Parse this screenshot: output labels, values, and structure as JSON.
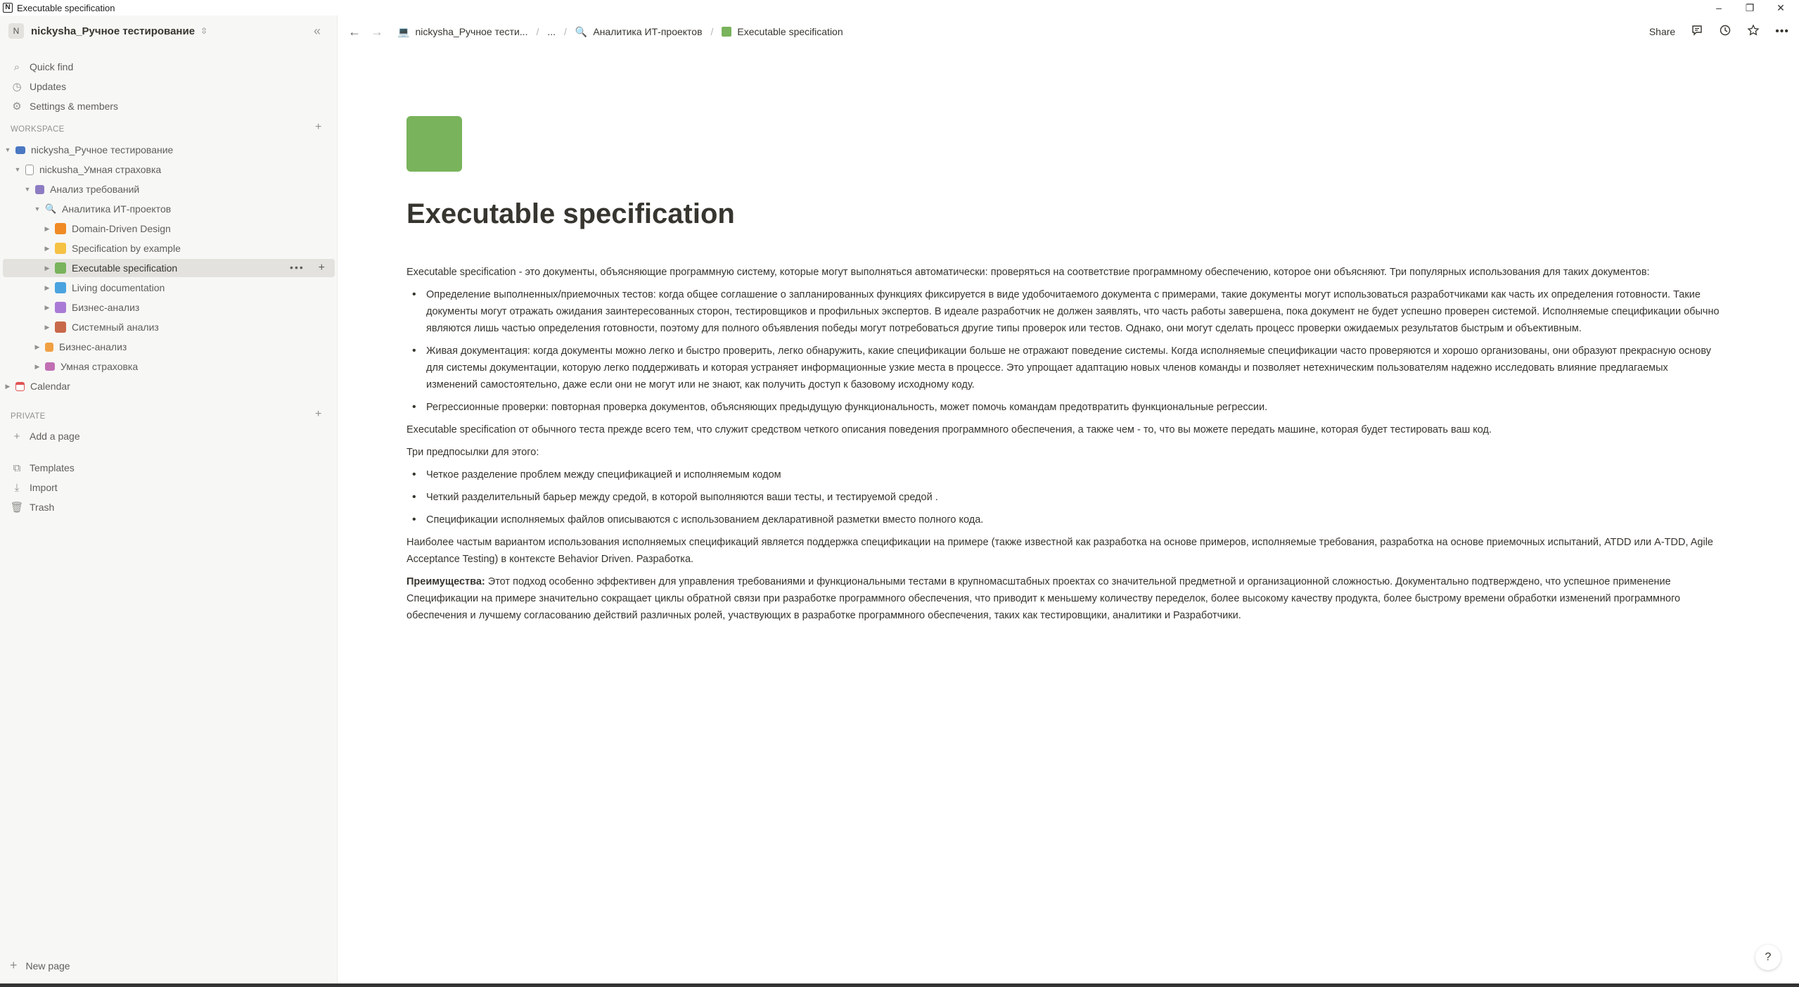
{
  "window": {
    "title": "Executable specification",
    "app_icon": "N",
    "controls": {
      "minimize": "–",
      "restore": "❐",
      "close": "✕"
    }
  },
  "sidebar": {
    "workspace_avatar": "N",
    "workspace_name": "nickysha_Ручное тестирование",
    "collapse_icon": "«",
    "nav": [
      {
        "label": "Quick find",
        "icon": "search-icon"
      },
      {
        "label": "Updates",
        "icon": "clock-icon"
      },
      {
        "label": "Settings & members",
        "icon": "gear-icon"
      }
    ],
    "workspace_label": "WORKSPACE",
    "private_label": "PRIVATE",
    "tree": [
      {
        "label": "nickysha_Ручное тестирование",
        "icon_color": "#4a78c2"
      },
      {
        "label": "nickusha_Умная страховка",
        "icon_color": "#9b9a97"
      },
      {
        "label": "Анализ требований",
        "icon_color": "#8e7cc3"
      },
      {
        "label": "Аналитика ИТ-проектов",
        "icon_color": "#4a78c2"
      },
      {
        "label": "Domain-Driven Design",
        "icon_color": "#f08a24"
      },
      {
        "label": "Specification by example",
        "icon_color": "#f5c244"
      },
      {
        "label": "Executable specification",
        "icon_color": "#79b35b"
      },
      {
        "label": "Living documentation",
        "icon_color": "#4aa3df"
      },
      {
        "label": "Бизнес-анализ",
        "icon_color": "#a97bd6"
      },
      {
        "label": "Системный анализ",
        "icon_color": "#c8684a"
      },
      {
        "label": "Бизнес-анализ",
        "icon_color": "#f0a043"
      },
      {
        "label": "Умная страховка",
        "icon_color": "#c06fb3"
      },
      {
        "label": "Calendar",
        "icon_color": "#e05252"
      }
    ],
    "add_page": "Add a page",
    "tools": [
      {
        "label": "Templates",
        "icon": "templates-icon"
      },
      {
        "label": "Import",
        "icon": "import-icon"
      },
      {
        "label": "Trash",
        "icon": "trash-icon"
      }
    ],
    "new_page": "New page",
    "row_more": "•••",
    "plus": "+"
  },
  "topbar": {
    "back": "←",
    "forward": "→",
    "breadcrumbs": [
      {
        "label": "nickysha_Ручное тести...",
        "icon": "💻"
      },
      {
        "label": "..."
      },
      {
        "label": "Аналитика ИТ-проектов",
        "icon": "🔍"
      },
      {
        "label": "Executable specification"
      }
    ],
    "share": "Share",
    "icons": [
      "comment-icon",
      "history-icon",
      "star-icon",
      "more-icon"
    ]
  },
  "page": {
    "title": "Executable specification",
    "icon_color": "#79b35b",
    "intro": "Executable specification - это документы, объясняющие программную систему, которые могут выполняться автоматически: проверяться на соответствие программному обеспечению, которое они объясняют. Три популярных использования для таких документов:",
    "uses": [
      "Определение выполненных/приемочных тестов: когда общее соглашение о запланированных функциях фиксируется в виде удобочитаемого документа с примерами, такие документы могут использоваться разработчиками как часть их определения готовности. Такие документы могут отражать ожидания заинтересованных сторон, тестировщиков и профильных экспертов. В идеале разработчик не должен заявлять, что часть работы завершена, пока документ не будет успешно проверен системой. Исполняемые спецификации обычно являются лишь частью определения готовности, поэтому для полного объявления победы могут потребоваться другие типы проверок или тестов. Однако, они могут сделать процесс проверки ожидаемых результатов быстрым и объективным.",
      "Живая документация: когда документы можно легко и быстро проверить, легко обнаружить, какие спецификации больше не отражают поведение системы. Когда исполняемые спецификации часто проверяются и хорошо организованы, они образуют прекрасную основу для системы документации, которую легко поддерживать и которая устраняет информационные узкие места в процессе. Это упрощает адаптацию новых членов команды и позволяет нетехническим пользователям надежно исследовать влияние предлагаемых изменений самостоятельно, даже если они не могут или не знают, как получить доступ к базовому исходному коду.",
      "Регрессионные проверки: повторная проверка документов, объясняющих предыдущую функциональность, может помочь командам предотвратить функциональные регрессии."
    ],
    "difference": "Executable specification от обычного теста прежде всего тем, что служит средством четкого описания поведения программного обеспечения, а также чем - то, что вы можете передать машине, которая будет тестировать ваш код.",
    "prereq_title": "Три предпосылки для этого:",
    "prereqs": [
      "Четкое разделение проблем между спецификацией и исполняемым кодом",
      "Четкий разделительный барьер между средой, в которой выполняются ваши тесты, и тестируемой средой .",
      "Спецификации исполняемых файлов описываются с использованием декларативной разметки вместо полного кода."
    ],
    "common_use": "Наиболее частым вариантом использования исполняемых спецификаций является поддержка спецификации на примере (также известной как разработка на основе примеров, исполняемые требования, разработка на основе приемочных испытаний, ATDD или A-TDD, Agile Acceptance Testing) в контексте Behavior Driven. Разработка.",
    "advantages_label": "Преимущества:",
    "advantages_text": " Этот подход особенно эффективен для управления требованиями и функциональными тестами в крупномасштабных проектах со значительной предметной и организационной сложностью. Документально подтверждено, что успешное применение Спецификации на примере значительно сокращает циклы обратной связи при разработке программного обеспечения, что приводит к меньшему количеству переделок, более высокому качеству продукта, более быстрому времени обработки изменений программного обеспечения и лучшему согласованию действий различных ролей, участвующих в разработке программного обеспечения, таких как тестировщики, аналитики и Разработчики."
  },
  "help": "?"
}
